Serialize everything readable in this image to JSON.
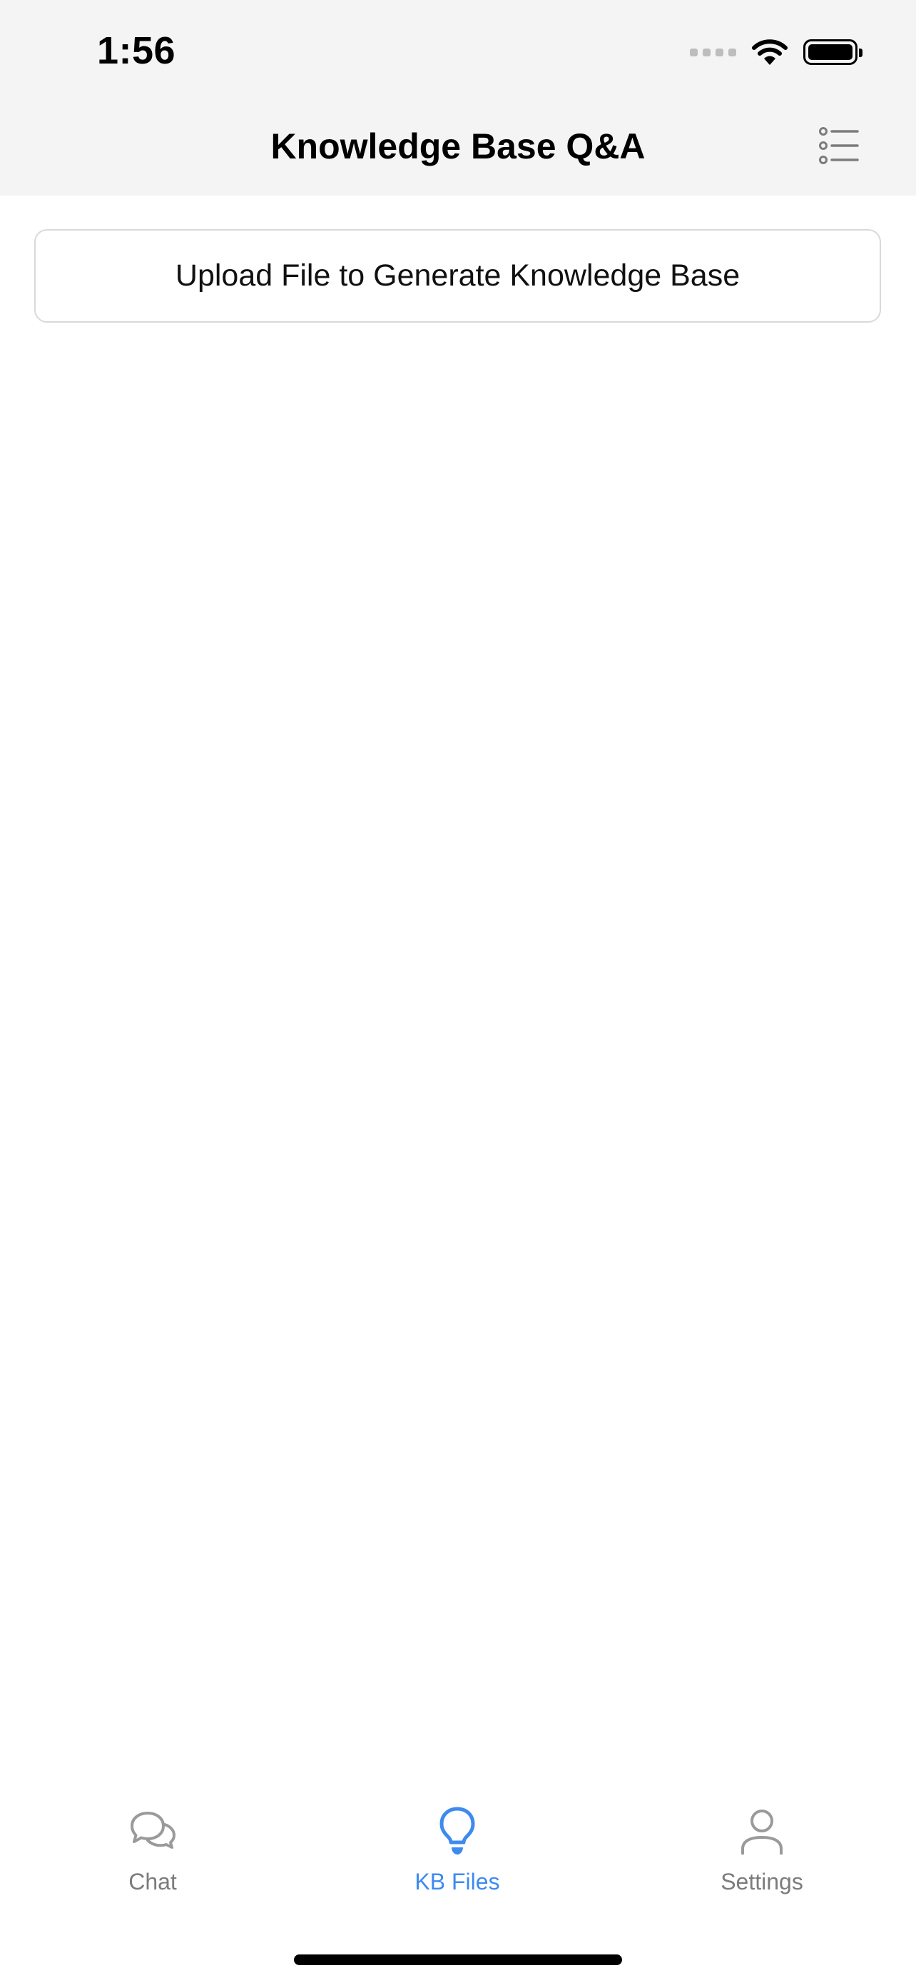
{
  "status_bar": {
    "time": "1:56",
    "icons": [
      "cellular-signal-icon",
      "wifi-icon",
      "battery-icon"
    ]
  },
  "header": {
    "title": "Knowledge Base Q&A",
    "menu_icon": "list-icon",
    "background": "#f4f4f4"
  },
  "main": {
    "upload_button_label": "Upload File to Generate Knowledge Base"
  },
  "tab_bar": {
    "active_color": "#3d8af0",
    "inactive_color": "#7c7c7c",
    "tabs": [
      {
        "label": "Chat",
        "icon": "chat-bubbles-icon",
        "active": false
      },
      {
        "label": "KB Files",
        "icon": "lightbulb-icon",
        "active": true
      },
      {
        "label": "Settings",
        "icon": "person-icon",
        "active": false
      }
    ]
  }
}
